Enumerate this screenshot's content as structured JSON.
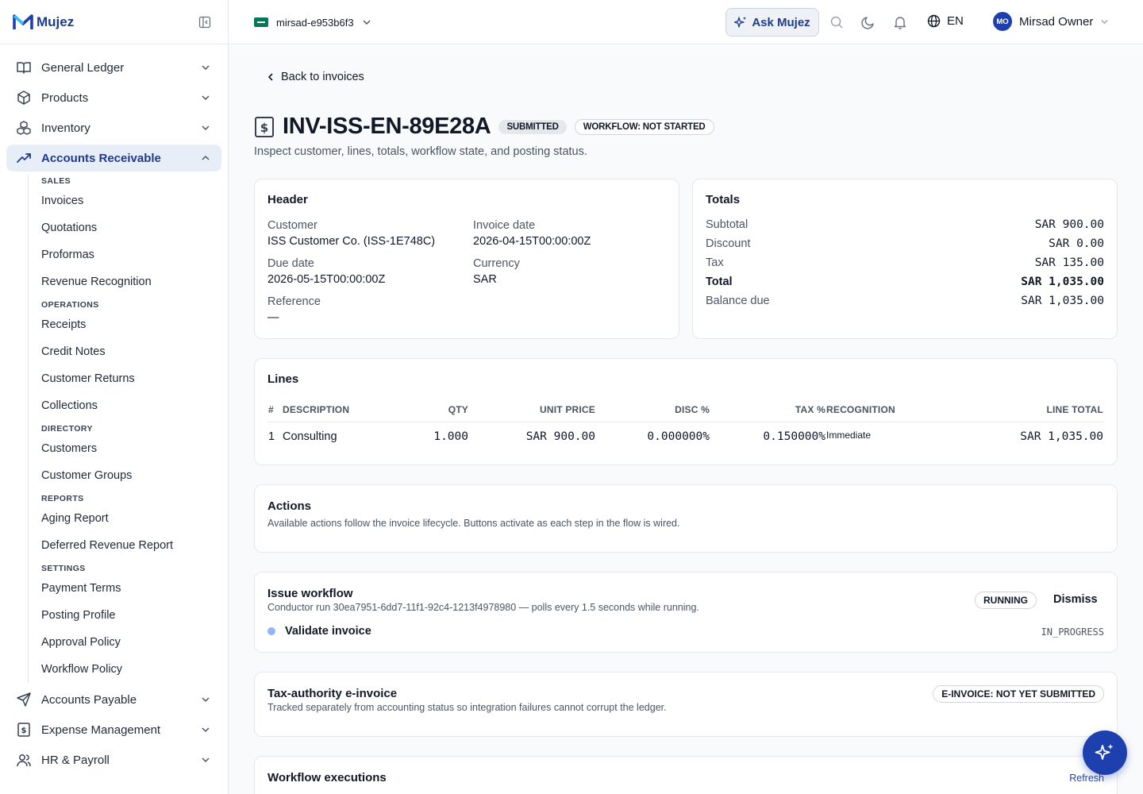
{
  "brand": {
    "name": "Mujez"
  },
  "sidebar": {
    "items": [
      {
        "label": "General Ledger",
        "icon": "book-icon"
      },
      {
        "label": "Products",
        "icon": "box-icon"
      },
      {
        "label": "Inventory",
        "icon": "boxes-icon"
      },
      {
        "label": "Accounts Receivable",
        "icon": "trending-up-icon",
        "active": true
      }
    ],
    "sub": {
      "sales_head": "SALES",
      "invoices": "Invoices",
      "quotations": "Quotations",
      "proformas": "Proformas",
      "revenue_recognition": "Revenue Recognition",
      "operations_head": "OPERATIONS",
      "receipts": "Receipts",
      "credit_notes": "Credit Notes",
      "customer_returns": "Customer Returns",
      "collections": "Collections",
      "directory_head": "DIRECTORY",
      "customers": "Customers",
      "customer_groups": "Customer Groups",
      "reports_head": "REPORTS",
      "aging_report": "Aging Report",
      "deferred_revenue_report": "Deferred Revenue Report",
      "settings_head": "SETTINGS",
      "payment_terms": "Payment Terms",
      "posting_profile": "Posting Profile",
      "approval_policy": "Approval Policy",
      "workflow_policy": "Workflow Policy"
    },
    "bottom": [
      {
        "label": "Accounts Payable",
        "icon": "send-icon"
      },
      {
        "label": "Expense Management",
        "icon": "receipt-dollar-icon"
      },
      {
        "label": "HR & Payroll",
        "icon": "users-icon"
      }
    ]
  },
  "topbar": {
    "tenant": "mirsad-e953b6f3",
    "ask": "Ask Mujez",
    "lang": "EN",
    "user_initials": "MO",
    "user_name": "Mirsad Owner"
  },
  "page": {
    "back": "Back to invoices",
    "title": "INV-ISS-EN-89E28A",
    "status_badge": "SUBMITTED",
    "workflow_badge": "WORKFLOW: NOT STARTED",
    "subtitle": "Inspect customer, lines, totals, workflow state, and posting status."
  },
  "header_card": {
    "title": "Header",
    "customer_label": "Customer",
    "customer_value": "ISS Customer Co. (ISS-1E748C)",
    "invoice_date_label": "Invoice date",
    "invoice_date_value": "2026-04-15T00:00:00Z",
    "due_date_label": "Due date",
    "due_date_value": "2026-05-15T00:00:00Z",
    "currency_label": "Currency",
    "currency_value": "SAR",
    "reference_label": "Reference",
    "reference_value": "—"
  },
  "totals_card": {
    "title": "Totals",
    "rows": [
      {
        "label": "Subtotal",
        "value": "SAR 900.00"
      },
      {
        "label": "Discount",
        "value": "SAR 0.00"
      },
      {
        "label": "Tax",
        "value": "SAR 135.00"
      },
      {
        "label": "Total",
        "value": "SAR 1,035.00"
      },
      {
        "label": "Balance due",
        "value": "SAR 1,035.00"
      }
    ]
  },
  "lines_card": {
    "title": "Lines",
    "columns": [
      "#",
      "DESCRIPTION",
      "QTY",
      "UNIT PRICE",
      "DISC %",
      "TAX %",
      "RECOGNITION",
      "LINE TOTAL"
    ],
    "rows": [
      {
        "num": "1",
        "description": "Consulting",
        "qty": "1.000",
        "unit_price": "SAR 900.00",
        "disc": "0.000000%",
        "tax": "0.150000%",
        "recognition": "Immediate",
        "line_total": "SAR 1,035.00"
      }
    ]
  },
  "actions_card": {
    "title": "Actions",
    "desc": "Available actions follow the invoice lifecycle. Buttons activate as each step in the flow is wired."
  },
  "issue_workflow": {
    "title": "Issue workflow",
    "desc": "Conductor run 30ea7951-6dd7-11f1-92c4-1213f4978980 — polls every 1.5 seconds while running.",
    "status": "RUNNING",
    "dismiss": "Dismiss",
    "step_label": "Validate invoice",
    "step_status": "IN_PROGRESS"
  },
  "einvoice": {
    "title": "Tax-authority e-invoice",
    "desc": "Tracked separately from accounting status so integration failures cannot corrupt the ledger.",
    "badge": "E-INVOICE: NOT YET SUBMITTED"
  },
  "executions": {
    "title": "Workflow executions",
    "refresh": "Refresh"
  },
  "colors": {
    "brand": "#1e40af",
    "active_bg": "#e8eef7",
    "step_dot": "#93b4f5"
  }
}
